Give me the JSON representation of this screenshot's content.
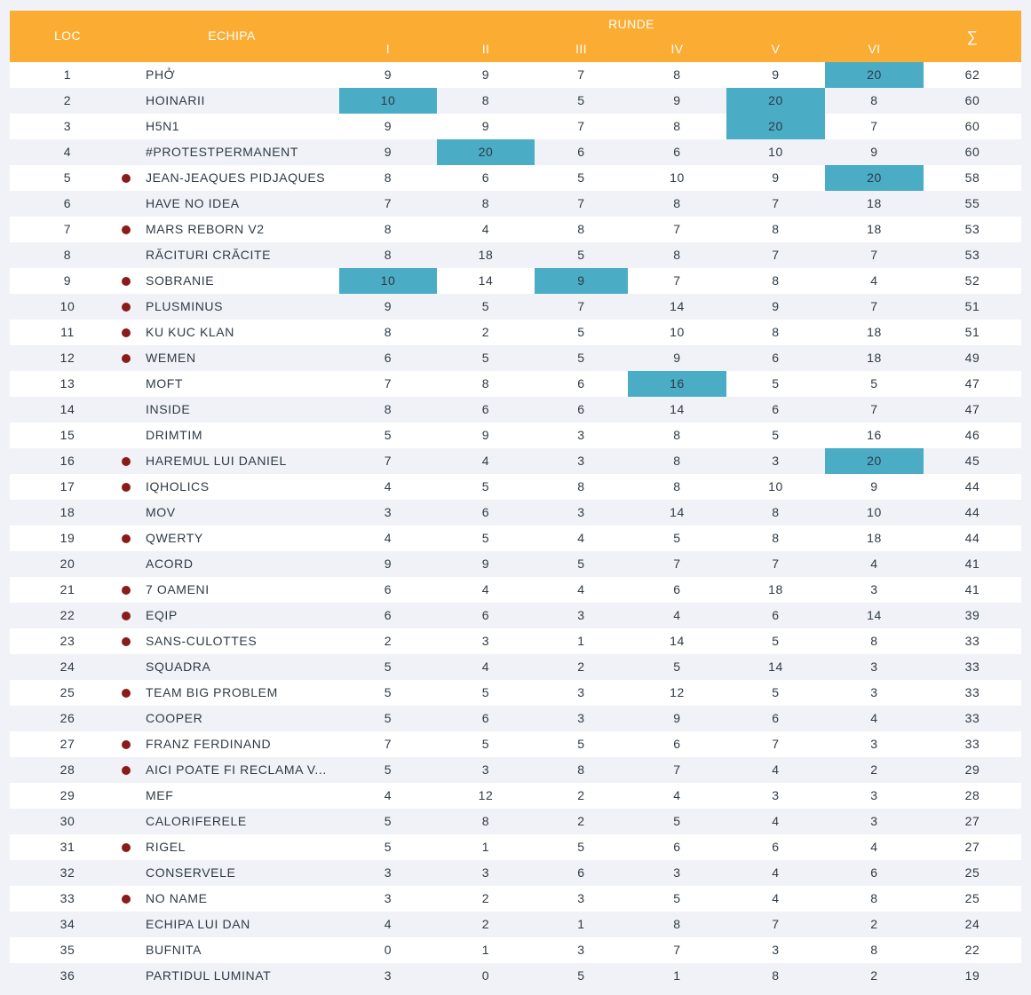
{
  "header": {
    "loc": "LOC",
    "team": "ECHIPA",
    "runde": "RUNDE",
    "rounds": [
      "I",
      "II",
      "III",
      "IV",
      "V",
      "VI"
    ],
    "sum": "∑"
  },
  "colors": {
    "header_bg": "#fbac33",
    "highlight": "#4bacc6",
    "marker": "#8b1a1a"
  },
  "rows": [
    {
      "loc": "1",
      "team": "PHỞ",
      "marker": false,
      "scores": [
        "9",
        "9",
        "7",
        "8",
        "9",
        "20"
      ],
      "hl": [
        5
      ],
      "total": "62"
    },
    {
      "loc": "2",
      "team": "HOINARII",
      "marker": false,
      "scores": [
        "10",
        "8",
        "5",
        "9",
        "20",
        "8"
      ],
      "hl": [
        0,
        4
      ],
      "total": "60"
    },
    {
      "loc": "3",
      "team": "H5N1",
      "marker": false,
      "scores": [
        "9",
        "9",
        "7",
        "8",
        "20",
        "7"
      ],
      "hl": [
        4
      ],
      "total": "60"
    },
    {
      "loc": "4",
      "team": "#PROTESTPERMANENT",
      "marker": false,
      "scores": [
        "9",
        "20",
        "6",
        "6",
        "10",
        "9"
      ],
      "hl": [
        1
      ],
      "total": "60"
    },
    {
      "loc": "5",
      "team": "JEAN-JEAQUES PIDJAQUES",
      "marker": true,
      "scores": [
        "8",
        "6",
        "5",
        "10",
        "9",
        "20"
      ],
      "hl": [
        5
      ],
      "total": "58"
    },
    {
      "loc": "6",
      "team": "HAVE NO IDEA",
      "marker": false,
      "scores": [
        "7",
        "8",
        "7",
        "8",
        "7",
        "18"
      ],
      "hl": [],
      "total": "55"
    },
    {
      "loc": "7",
      "team": "MARS REBORN V2",
      "marker": true,
      "scores": [
        "8",
        "4",
        "8",
        "7",
        "8",
        "18"
      ],
      "hl": [],
      "total": "53"
    },
    {
      "loc": "8",
      "team": "RĂCITURI CRĂCITE",
      "marker": false,
      "scores": [
        "8",
        "18",
        "5",
        "8",
        "7",
        "7"
      ],
      "hl": [],
      "total": "53"
    },
    {
      "loc": "9",
      "team": "SOBRANIE",
      "marker": true,
      "scores": [
        "10",
        "14",
        "9",
        "7",
        "8",
        "4"
      ],
      "hl": [
        0,
        2
      ],
      "total": "52"
    },
    {
      "loc": "10",
      "team": "PLUSMINUS",
      "marker": true,
      "scores": [
        "9",
        "5",
        "7",
        "14",
        "9",
        "7"
      ],
      "hl": [],
      "total": "51"
    },
    {
      "loc": "11",
      "team": "KU KUC KLAN",
      "marker": true,
      "scores": [
        "8",
        "2",
        "5",
        "10",
        "8",
        "18"
      ],
      "hl": [],
      "total": "51"
    },
    {
      "loc": "12",
      "team": "WEMEN",
      "marker": true,
      "scores": [
        "6",
        "5",
        "5",
        "9",
        "6",
        "18"
      ],
      "hl": [],
      "total": "49"
    },
    {
      "loc": "13",
      "team": "MOFT",
      "marker": false,
      "scores": [
        "7",
        "8",
        "6",
        "16",
        "5",
        "5"
      ],
      "hl": [
        3
      ],
      "total": "47"
    },
    {
      "loc": "14",
      "team": "INSIDE",
      "marker": false,
      "scores": [
        "8",
        "6",
        "6",
        "14",
        "6",
        "7"
      ],
      "hl": [],
      "total": "47"
    },
    {
      "loc": "15",
      "team": "DRIMTIM",
      "marker": false,
      "scores": [
        "5",
        "9",
        "3",
        "8",
        "5",
        "16"
      ],
      "hl": [],
      "total": "46"
    },
    {
      "loc": "16",
      "team": "HAREMUL LUI DANIEL",
      "marker": true,
      "scores": [
        "7",
        "4",
        "3",
        "8",
        "3",
        "20"
      ],
      "hl": [
        5
      ],
      "total": "45"
    },
    {
      "loc": "17",
      "team": "IQHOLICS",
      "marker": true,
      "scores": [
        "4",
        "5",
        "8",
        "8",
        "10",
        "9"
      ],
      "hl": [],
      "total": "44"
    },
    {
      "loc": "18",
      "team": "MOV",
      "marker": false,
      "scores": [
        "3",
        "6",
        "3",
        "14",
        "8",
        "10"
      ],
      "hl": [],
      "total": "44"
    },
    {
      "loc": "19",
      "team": "QWERTY",
      "marker": true,
      "scores": [
        "4",
        "5",
        "4",
        "5",
        "8",
        "18"
      ],
      "hl": [],
      "total": "44"
    },
    {
      "loc": "20",
      "team": "ACORD",
      "marker": false,
      "scores": [
        "9",
        "9",
        "5",
        "7",
        "7",
        "4"
      ],
      "hl": [],
      "total": "41"
    },
    {
      "loc": "21",
      "team": "7 OAMENI",
      "marker": true,
      "scores": [
        "6",
        "4",
        "4",
        "6",
        "18",
        "3"
      ],
      "hl": [],
      "total": "41"
    },
    {
      "loc": "22",
      "team": "EQIP",
      "marker": true,
      "scores": [
        "6",
        "6",
        "3",
        "4",
        "6",
        "14"
      ],
      "hl": [],
      "total": "39"
    },
    {
      "loc": "23",
      "team": "SANS-CULOTTES",
      "marker": true,
      "scores": [
        "2",
        "3",
        "1",
        "14",
        "5",
        "8"
      ],
      "hl": [],
      "total": "33"
    },
    {
      "loc": "24",
      "team": "SQUADRA",
      "marker": false,
      "scores": [
        "5",
        "4",
        "2",
        "5",
        "14",
        "3"
      ],
      "hl": [],
      "total": "33"
    },
    {
      "loc": "25",
      "team": "TEAM BIG PROBLEM",
      "marker": true,
      "scores": [
        "5",
        "5",
        "3",
        "12",
        "5",
        "3"
      ],
      "hl": [],
      "total": "33"
    },
    {
      "loc": "26",
      "team": "COOPER",
      "marker": false,
      "scores": [
        "5",
        "6",
        "3",
        "9",
        "6",
        "4"
      ],
      "hl": [],
      "total": "33"
    },
    {
      "loc": "27",
      "team": "FRANZ FERDINAND",
      "marker": true,
      "scores": [
        "7",
        "5",
        "5",
        "6",
        "7",
        "3"
      ],
      "hl": [],
      "total": "33"
    },
    {
      "loc": "28",
      "team": "AICI POATE FI RECLAMA V...",
      "marker": true,
      "scores": [
        "5",
        "3",
        "8",
        "7",
        "4",
        "2"
      ],
      "hl": [],
      "total": "29"
    },
    {
      "loc": "29",
      "team": "MEF",
      "marker": false,
      "scores": [
        "4",
        "12",
        "2",
        "4",
        "3",
        "3"
      ],
      "hl": [],
      "total": "28"
    },
    {
      "loc": "30",
      "team": "CALORIFERELE",
      "marker": false,
      "scores": [
        "5",
        "8",
        "2",
        "5",
        "4",
        "3"
      ],
      "hl": [],
      "total": "27"
    },
    {
      "loc": "31",
      "team": "RIGEL",
      "marker": true,
      "scores": [
        "5",
        "1",
        "5",
        "6",
        "6",
        "4"
      ],
      "hl": [],
      "total": "27"
    },
    {
      "loc": "32",
      "team": "CONSERVELE",
      "marker": false,
      "scores": [
        "3",
        "3",
        "6",
        "3",
        "4",
        "6"
      ],
      "hl": [],
      "total": "25"
    },
    {
      "loc": "33",
      "team": "NO NAME",
      "marker": true,
      "scores": [
        "3",
        "2",
        "3",
        "5",
        "4",
        "8"
      ],
      "hl": [],
      "total": "25"
    },
    {
      "loc": "34",
      "team": "ECHIPA LUI DAN",
      "marker": false,
      "scores": [
        "4",
        "2",
        "1",
        "8",
        "7",
        "2"
      ],
      "hl": [],
      "total": "24"
    },
    {
      "loc": "35",
      "team": "BUFNITA",
      "marker": false,
      "scores": [
        "0",
        "1",
        "3",
        "7",
        "3",
        "8"
      ],
      "hl": [],
      "total": "22"
    },
    {
      "loc": "36",
      "team": "PARTIDUL LUMINAT",
      "marker": false,
      "scores": [
        "3",
        "0",
        "5",
        "1",
        "8",
        "2"
      ],
      "hl": [],
      "total": "19"
    }
  ]
}
